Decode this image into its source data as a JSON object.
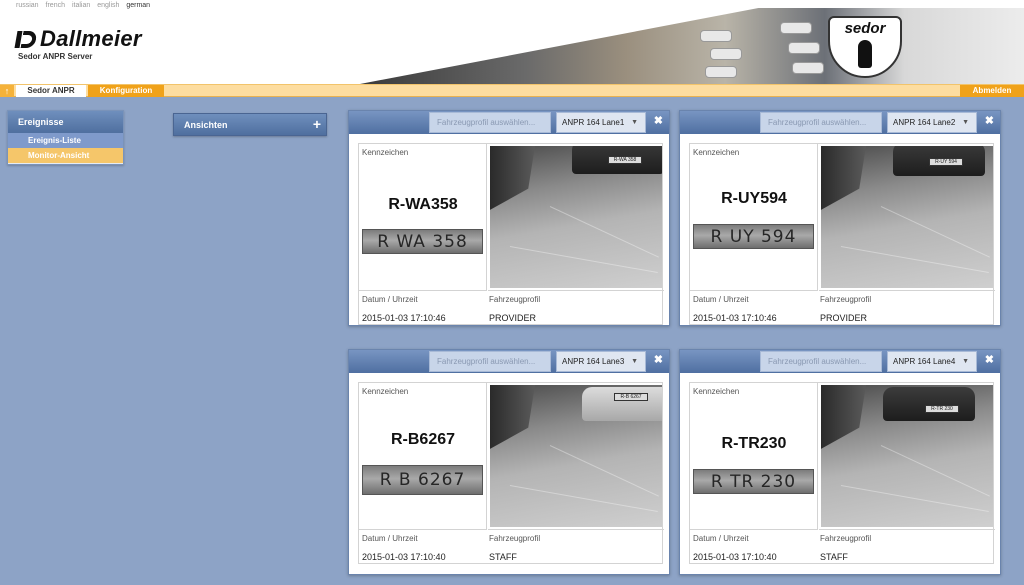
{
  "header": {
    "languages": [
      "russian",
      "french",
      "italian",
      "english",
      "german"
    ],
    "active_language": "german",
    "logo_text": "Dallmeier",
    "server_title": "Sedor ANPR Server",
    "banner_logo_text": "sedor"
  },
  "nav": {
    "home_icon": "↑",
    "tab_active": "Sedor ANPR",
    "tab_config": "Konfiguration",
    "logout": "Abmelden"
  },
  "sidebar": {
    "events_title": "Ereignisse",
    "items": [
      {
        "label": "Ereignis-Liste"
      },
      {
        "label": "Monitor-Ansicht"
      }
    ],
    "views_title": "Ansichten",
    "views_plus": "+"
  },
  "cards": [
    {
      "profile_placeholder": "Fahrzeugprofil auswählen...",
      "lane": "ANPR 164 Lane1",
      "plate_label": "Kennzeichen",
      "plate": "R-WA358",
      "plate_crop": "R WA 358",
      "date_label": "Datum / Uhrzeit",
      "date": "2015-01-03 17:10:46",
      "profile_label": "Fahrzeugprofil",
      "profile": "PROVIDER",
      "cam_plate": "R-WA 358"
    },
    {
      "profile_placeholder": "Fahrzeugprofil auswählen...",
      "lane": "ANPR 164 Lane2",
      "plate_label": "Kennzeichen",
      "plate": "R-UY594",
      "plate_crop": "R UY 594",
      "date_label": "Datum / Uhrzeit",
      "date": "2015-01-03 17:10:46",
      "profile_label": "Fahrzeugprofil",
      "profile": "PROVIDER",
      "cam_plate": "R-UY 594"
    },
    {
      "profile_placeholder": "Fahrzeugprofil auswählen...",
      "lane": "ANPR 164 Lane3",
      "plate_label": "Kennzeichen",
      "plate": "R-B6267",
      "plate_crop": "R B 6267",
      "date_label": "Datum / Uhrzeit",
      "date": "2015-01-03 17:10:40",
      "profile_label": "Fahrzeugprofil",
      "profile": "STAFF",
      "cam_plate": "R-B 6267"
    },
    {
      "profile_placeholder": "Fahrzeugprofil auswählen...",
      "lane": "ANPR 164 Lane4",
      "plate_label": "Kennzeichen",
      "plate": "R-TR230",
      "plate_crop": "R TR 230",
      "date_label": "Datum / Uhrzeit",
      "date": "2015-01-03 17:10:40",
      "profile_label": "Fahrzeugprofil",
      "profile": "STAFF",
      "cam_plate": "R-TR 230"
    }
  ],
  "icons": {
    "close": "✖",
    "caret": "▼"
  },
  "colors": {
    "background": "#8da3c6",
    "accent_orange": "#f0a21a",
    "panel_header_blue": "#4f6fa1"
  }
}
